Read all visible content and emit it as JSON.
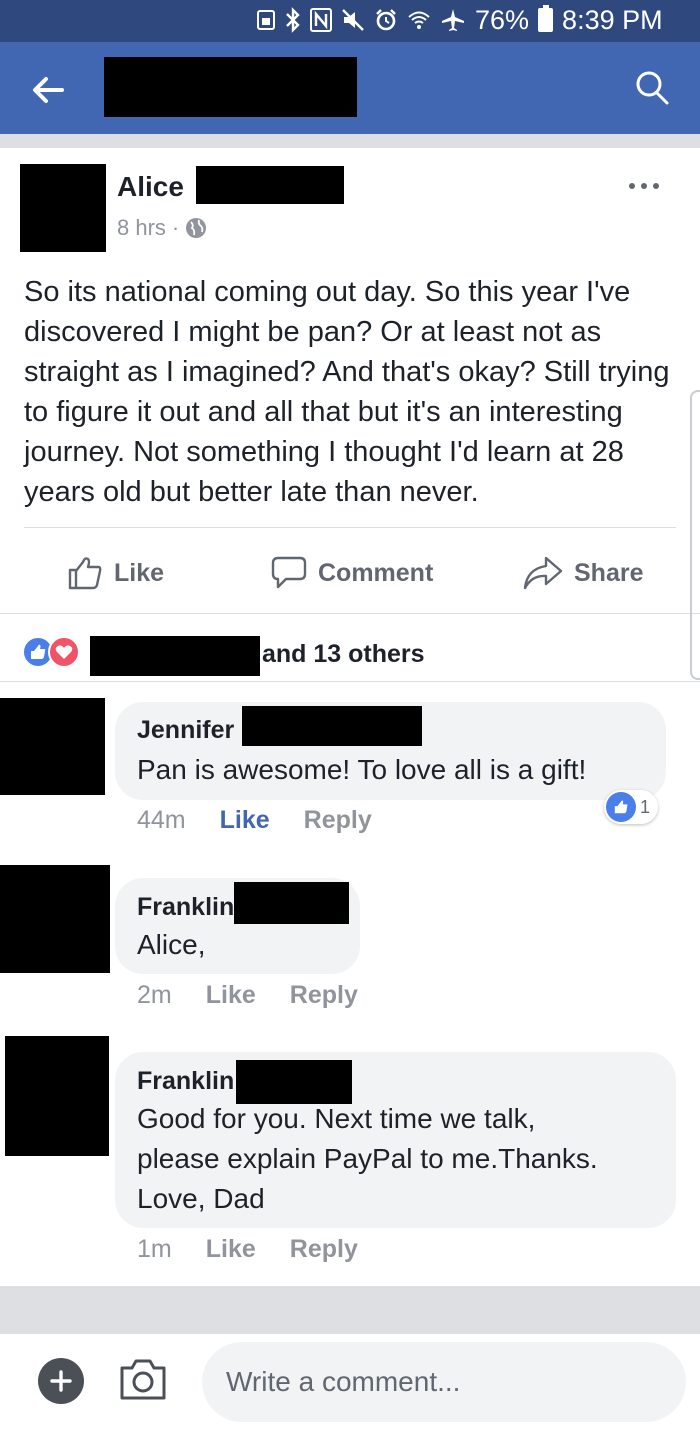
{
  "status_bar": {
    "battery_percent": "76%",
    "time": "8:39 PM",
    "icons": [
      "sim-icon",
      "bluetooth-icon",
      "nfc-icon",
      "mute-icon",
      "alarm-icon",
      "wifi-icon",
      "airplane-icon",
      "battery-icon"
    ]
  },
  "app_bar": {
    "back_icon": "arrow-left-icon",
    "search_icon": "search-icon"
  },
  "post": {
    "author": "Alice",
    "time": "8 hrs",
    "separator": "·",
    "privacy_icon": "globe-icon",
    "more_icon": "more-dots-icon",
    "text": "So its national coming out day. So this year I've discovered I might be pan? Or at least not as straight as I imagined? And that's okay? Still trying to figure it out and all that but it's an interesting journey. Not something I thought I'd learn at 28 years old but better late than never."
  },
  "actions": {
    "like": "Like",
    "comment": "Comment",
    "share": "Share"
  },
  "reactions": {
    "summary": "and 13 others",
    "types": [
      "like",
      "love"
    ]
  },
  "comments": [
    {
      "name": "Jennifer",
      "text": "Pan is awesome! To love all is a gift!",
      "time": "44m",
      "like": "Like",
      "reply": "Reply",
      "like_count": "1",
      "liked": true
    },
    {
      "name": "Franklin",
      "text": "Alice,",
      "time": "2m",
      "like": "Like",
      "reply": "Reply"
    },
    {
      "name": "Franklin",
      "text_lines": [
        "Good for you. Next time we talk,",
        "please explain PayPal to me.Thanks.",
        "Love, Dad"
      ],
      "time": "1m",
      "like": "Like",
      "reply": "Reply"
    }
  ],
  "composer": {
    "placeholder": "Write a comment..."
  },
  "colors": {
    "status_bar": "#2f497f",
    "app_bar": "#4267b2",
    "like_blue": "#4a7ee8",
    "love_red": "#f25268",
    "bubble": "#f2f3f5",
    "meta_gray": "#90949c"
  }
}
